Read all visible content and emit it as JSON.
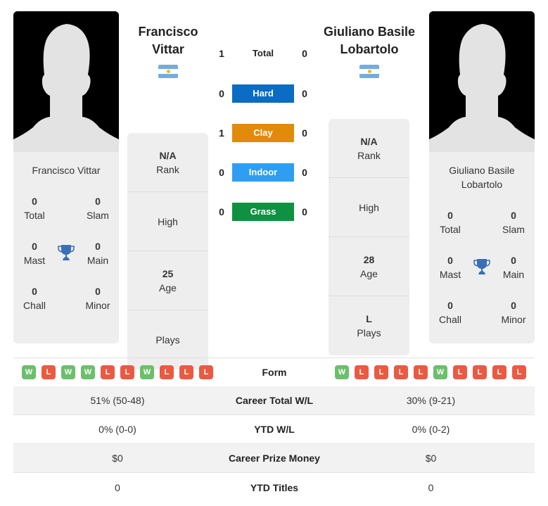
{
  "colors": {
    "hard": "#0a6cc2",
    "clay": "#e08c0a",
    "indoor": "#2f9ef2",
    "grass": "#0f9141",
    "win": "#6cbf6c",
    "loss": "#ea5a43",
    "trophy": "#3a6fb8"
  },
  "player1": {
    "header_name_line1": "Francisco",
    "header_name_line2": "Vittar",
    "flag": "argentina-flag",
    "card_name": "Francisco Vittar",
    "titles": {
      "total": {
        "value": "0",
        "label": "Total"
      },
      "slam": {
        "value": "0",
        "label": "Slam"
      },
      "mast": {
        "value": "0",
        "label": "Mast"
      },
      "main": {
        "value": "0",
        "label": "Main"
      },
      "chall": {
        "value": "0",
        "label": "Chall"
      },
      "minor": {
        "value": "0",
        "label": "Minor"
      }
    },
    "info": {
      "rank": {
        "value": "N/A",
        "label": "Rank"
      },
      "high": {
        "value": "",
        "label": "High"
      },
      "age": {
        "value": "25",
        "label": "Age"
      },
      "plays": {
        "value": "",
        "label": "Plays"
      }
    },
    "form": [
      "W",
      "L",
      "W",
      "W",
      "L",
      "L",
      "W",
      "L",
      "L",
      "L"
    ]
  },
  "player2": {
    "header_name_line1": "Giuliano Basile",
    "header_name_line2": "Lobartolo",
    "flag": "argentina-flag",
    "card_name_line1": "Giuliano Basile",
    "card_name_line2": "Lobartolo",
    "titles": {
      "total": {
        "value": "0",
        "label": "Total"
      },
      "slam": {
        "value": "0",
        "label": "Slam"
      },
      "mast": {
        "value": "0",
        "label": "Mast"
      },
      "main": {
        "value": "0",
        "label": "Main"
      },
      "chall": {
        "value": "0",
        "label": "Chall"
      },
      "minor": {
        "value": "0",
        "label": "Minor"
      }
    },
    "info": {
      "rank": {
        "value": "N/A",
        "label": "Rank"
      },
      "high": {
        "value": "",
        "label": "High"
      },
      "age": {
        "value": "28",
        "label": "Age"
      },
      "plays": {
        "value": "L",
        "label": "Plays"
      }
    },
    "form": [
      "W",
      "L",
      "L",
      "L",
      "L",
      "W",
      "L",
      "L",
      "L",
      "L"
    ]
  },
  "h2h": [
    {
      "label": "Total",
      "p1": "1",
      "p2": "0",
      "surface": "total"
    },
    {
      "label": "Hard",
      "p1": "0",
      "p2": "0",
      "surface": "hard"
    },
    {
      "label": "Clay",
      "p1": "1",
      "p2": "0",
      "surface": "clay"
    },
    {
      "label": "Indoor",
      "p1": "0",
      "p2": "0",
      "surface": "indoor"
    },
    {
      "label": "Grass",
      "p1": "0",
      "p2": "0",
      "surface": "grass"
    }
  ],
  "form_label": "Form",
  "stats": [
    {
      "label": "Career Total W/L",
      "p1": "51% (50-48)",
      "p2": "30% (9-21)"
    },
    {
      "label": "YTD W/L",
      "p1": "0% (0-0)",
      "p2": "0% (0-2)"
    },
    {
      "label": "Career Prize Money",
      "p1": "$0",
      "p2": "$0"
    },
    {
      "label": "YTD Titles",
      "p1": "0",
      "p2": "0"
    }
  ]
}
